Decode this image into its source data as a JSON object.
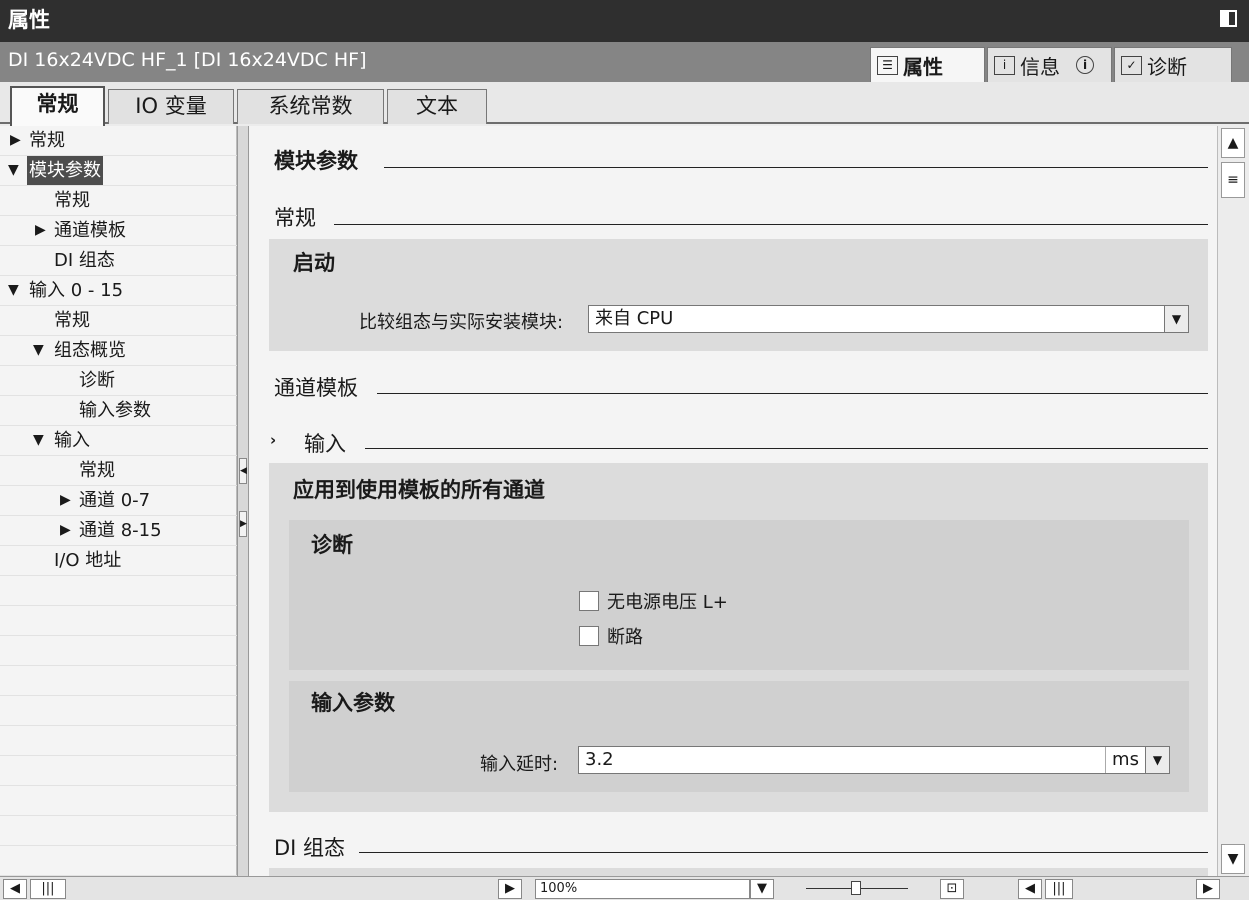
{
  "window": {
    "title": "属性"
  },
  "object": {
    "name": "DI 16x24VDC HF_1 [DI 16x24VDC HF]"
  },
  "inspector_tabs": [
    {
      "label": "属性",
      "icon": "properties-icon",
      "active": true
    },
    {
      "label": "信息",
      "icon": "info-icon",
      "active": false
    },
    {
      "label": "诊断",
      "icon": "diagnostics-icon",
      "active": false
    }
  ],
  "info_badge": "i",
  "tabs": [
    {
      "label": "常规",
      "active": true
    },
    {
      "label": "IO 变量",
      "active": false
    },
    {
      "label": "系统常数",
      "active": false
    },
    {
      "label": "文本",
      "active": false
    }
  ],
  "nav": [
    {
      "label": "常规",
      "arrow": "▶",
      "level": 0
    },
    {
      "label": "模块参数",
      "arrow": "▼",
      "level": 0,
      "selected": true
    },
    {
      "label": "常规",
      "arrow": "",
      "level": 1
    },
    {
      "label": "通道模板",
      "arrow": "▶",
      "level": 1
    },
    {
      "label": "DI 组态",
      "arrow": "",
      "level": 1
    },
    {
      "label": "输入 0 - 15",
      "arrow": "▼",
      "level": 0
    },
    {
      "label": "常规",
      "arrow": "",
      "level": 1
    },
    {
      "label": "组态概览",
      "arrow": "▼",
      "level": 1
    },
    {
      "label": "诊断",
      "arrow": "",
      "level": 2
    },
    {
      "label": "输入参数",
      "arrow": "",
      "level": 2
    },
    {
      "label": "输入",
      "arrow": "▼",
      "level": 1
    },
    {
      "label": "常规",
      "arrow": "",
      "level": 2
    },
    {
      "label": "通道 0-7",
      "arrow": "▶",
      "level": 2
    },
    {
      "label": "通道 8-15",
      "arrow": "▶",
      "level": 2
    },
    {
      "label": "I/O 地址",
      "arrow": "",
      "level": 1
    }
  ],
  "content": {
    "module_params_title": "模块参数",
    "general_title": "常规",
    "startup": {
      "title": "启动",
      "compare_label": "比较组态与实际安装模块:",
      "compare_value": "来自 CPU"
    },
    "channel_template_title": "通道模板",
    "input_title": "输入",
    "apply_title": "应用到使用模板的所有通道",
    "diagnostics": {
      "title": "诊断",
      "no_supply_label": "无电源电压 L+",
      "no_supply_checked": false,
      "wire_break_label": "断路",
      "wire_break_checked": false
    },
    "input_params": {
      "title": "输入参数",
      "delay_label": "输入延时:",
      "delay_value": "3.2",
      "delay_unit": "ms"
    },
    "di_config_title": "DI 组态"
  },
  "statusbar": {
    "zoom": "100%"
  }
}
